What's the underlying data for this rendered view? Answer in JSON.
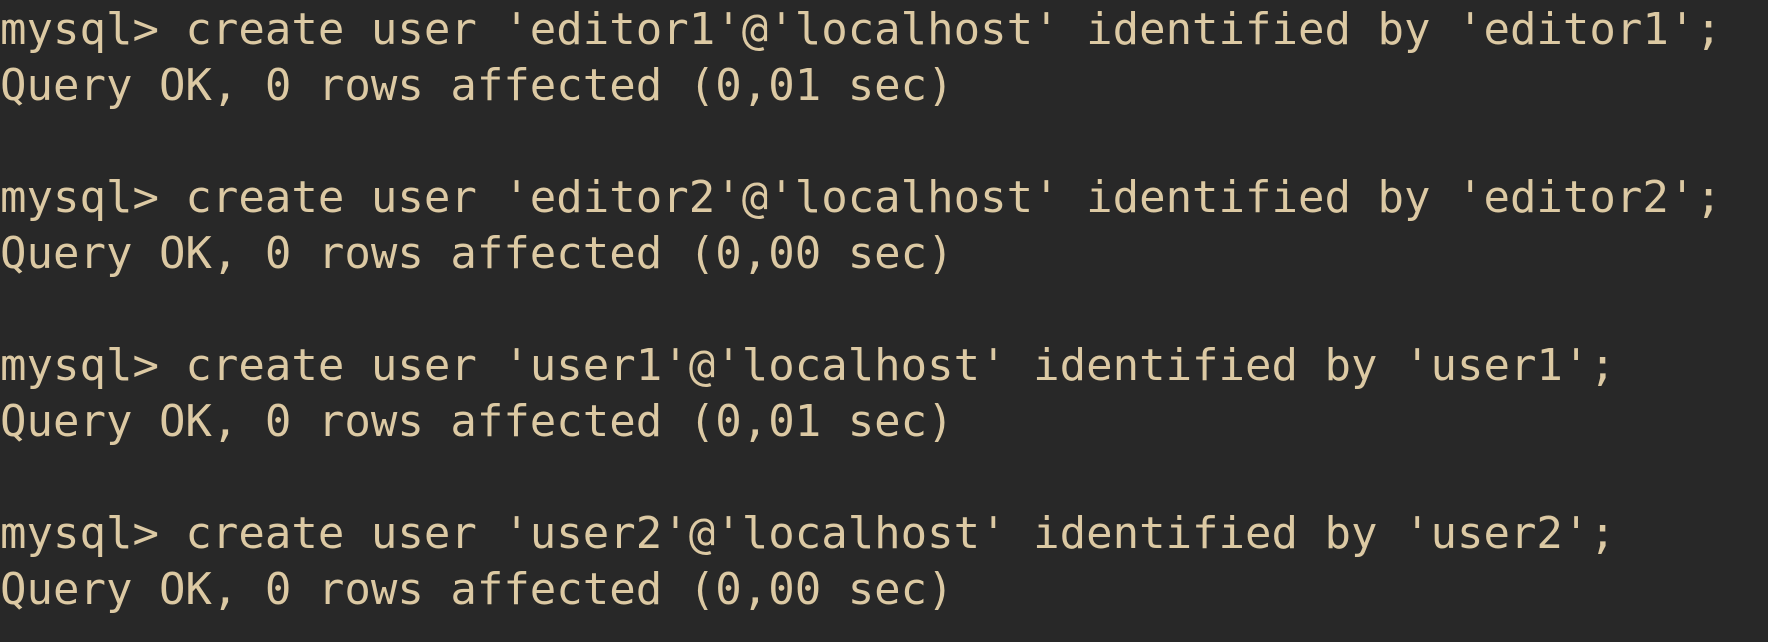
{
  "terminal": {
    "scroll_remnant": ",",
    "entries": [
      {
        "command_line": "mysql> create user 'editor1'@'localhost' identified by 'editor1';",
        "result_line": "Query OK, 0 rows affected (0,01 sec)"
      },
      {
        "command_line": "mysql> create user 'editor2'@'localhost' identified by 'editor2';",
        "result_line": "Query OK, 0 rows affected (0,00 sec)"
      },
      {
        "command_line": "mysql> create user 'user1'@'localhost' identified by 'user1';",
        "result_line": "Query OK, 0 rows affected (0,01 sec)"
      },
      {
        "command_line": "mysql> create user 'user2'@'localhost' identified by 'user2';",
        "result_line": "Query OK, 0 rows affected (0,00 sec)"
      }
    ]
  }
}
